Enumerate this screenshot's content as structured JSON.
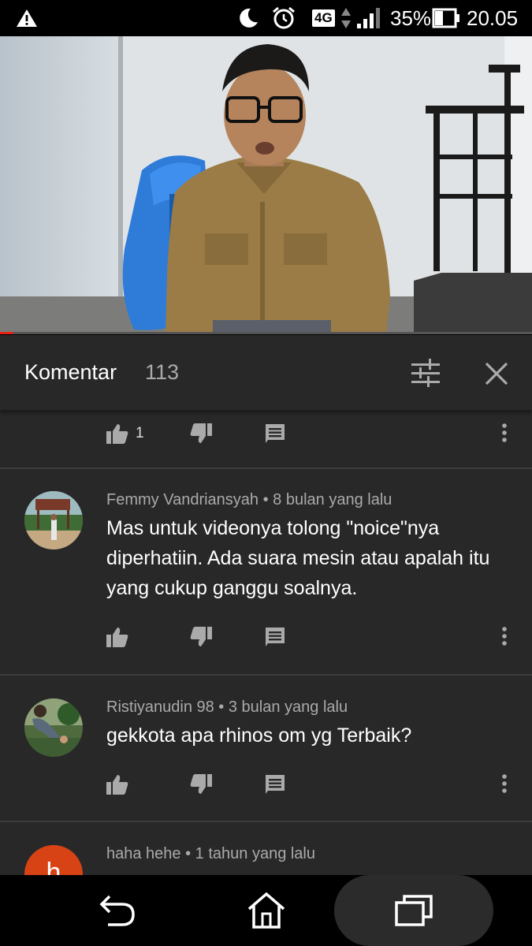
{
  "status_bar": {
    "network": "4G",
    "battery_percent": "35%",
    "time": "20.05",
    "icons": [
      "warning-icon",
      "moon-icon",
      "alarm-icon",
      "lte-badge",
      "data-arrows-icon",
      "signal-icon",
      "battery-icon"
    ]
  },
  "video": {
    "progress_fraction": 0.025
  },
  "comments_panel": {
    "title": "Komentar",
    "count": "113",
    "icons": [
      "sort-icon",
      "close-icon"
    ]
  },
  "comments": [
    {
      "like_count": "1"
    },
    {
      "author": "Femmy Vandriansyah • 8 bulan yang lalu",
      "text": "Mas untuk videonya tolong \"noice\"nya diperhatiin. Ada suara mesin atau apalah itu yang cukup ganggu soalnya.",
      "avatar": "avatar-outdoor-sign"
    },
    {
      "author": "Ristiyanudin 98 • 3 bulan yang lalu",
      "text": "gekkota apa rhinos om yg Terbaik?",
      "avatar": "avatar-person-plants"
    },
    {
      "author": "haha hehe • 1 tahun yang lalu",
      "avatar_letter": "h",
      "avatar_color": "#d84315"
    }
  ],
  "colors": {
    "panel_bg": "#282828",
    "progress": "#e62117",
    "divider": "#3d3d3d"
  },
  "nav_bar": {
    "icons": [
      "back-icon",
      "home-icon",
      "recent-apps-icon"
    ]
  }
}
